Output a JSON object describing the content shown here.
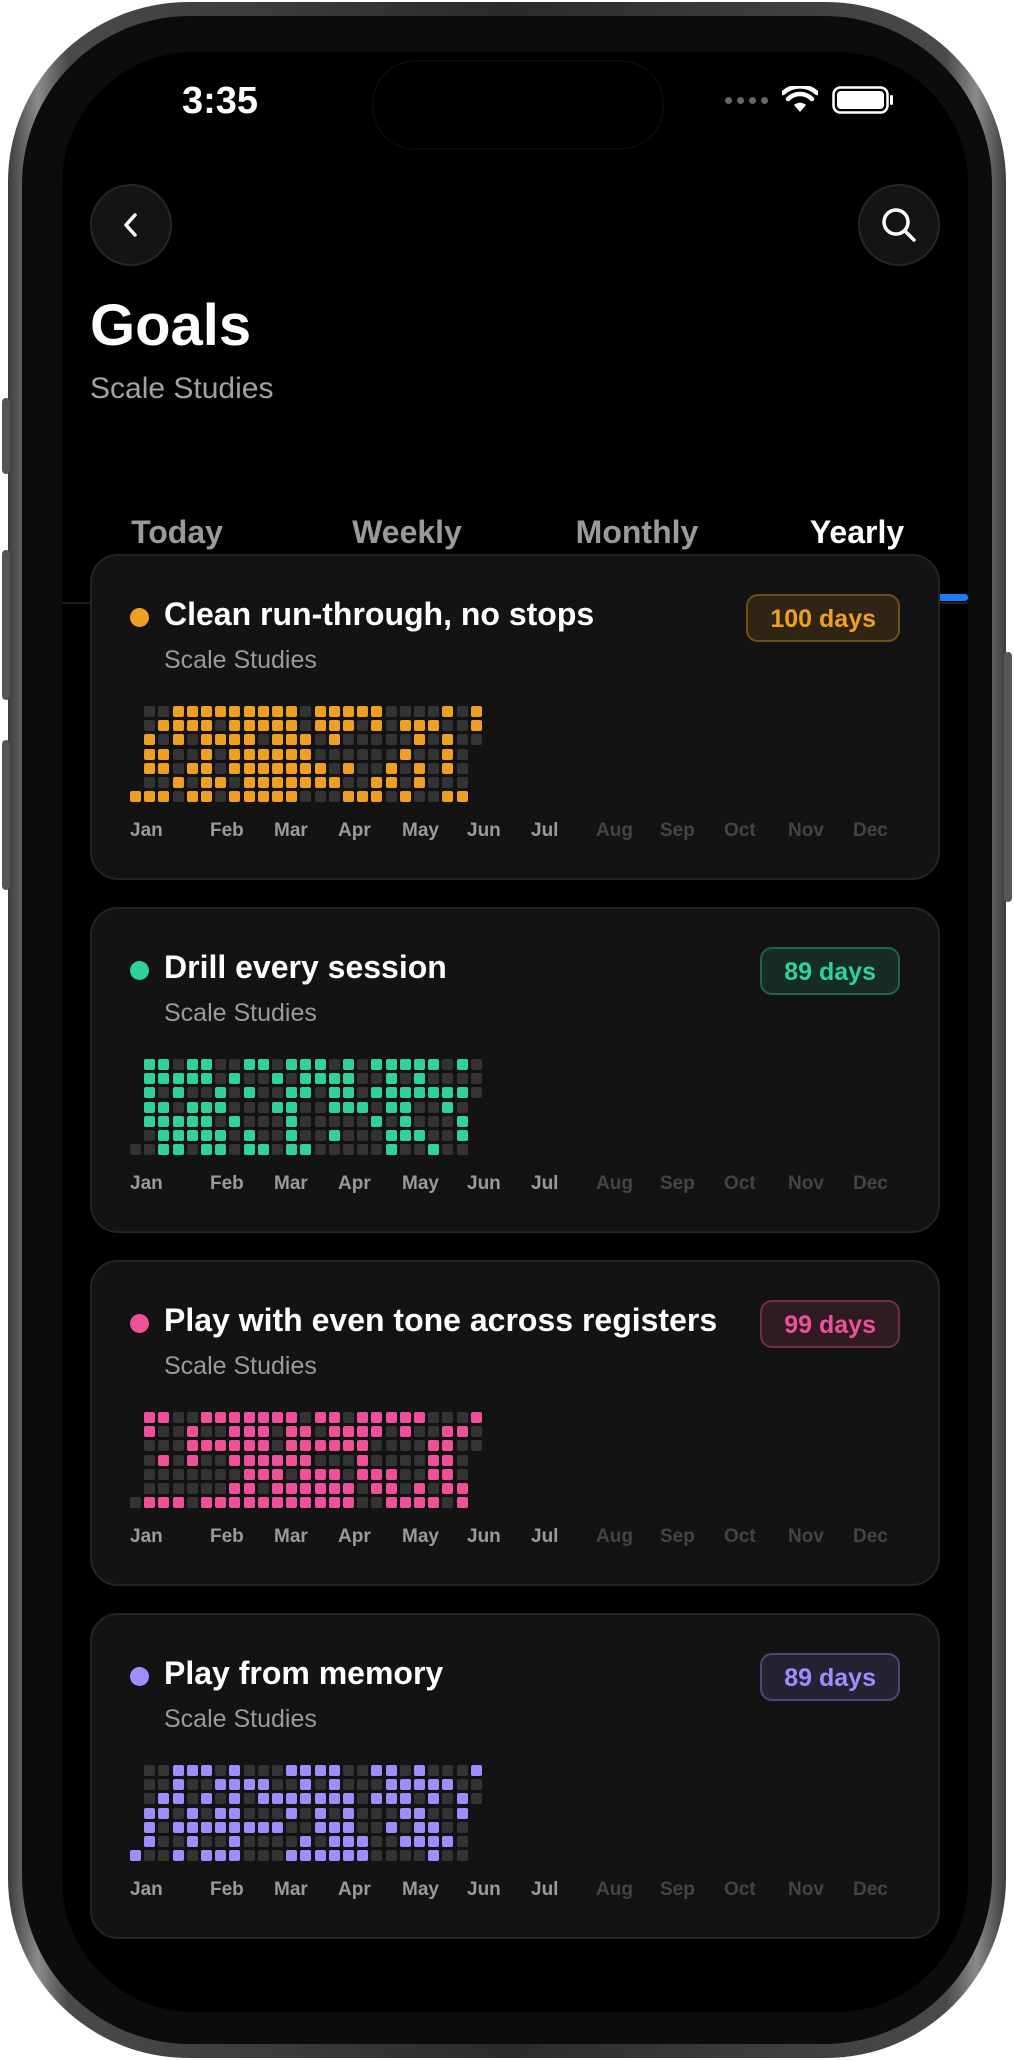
{
  "status": {
    "time": "3:35"
  },
  "header": {
    "title": "Goals",
    "subtitle": "Scale Studies"
  },
  "tabs": [
    {
      "label": "Today",
      "active": false
    },
    {
      "label": "Weekly",
      "active": false
    },
    {
      "label": "Monthly",
      "active": false
    },
    {
      "label": "Yearly",
      "active": true
    }
  ],
  "months": [
    "Jan",
    "Feb",
    "Mar",
    "Apr",
    "May",
    "Jun",
    "Jul",
    "Aug",
    "Sep",
    "Oct",
    "Nov",
    "Dec"
  ],
  "goals": [
    {
      "title": "Clean run-through, no stops",
      "subtitle": "Scale Studies",
      "badge": "100 days",
      "color": "#f0a020",
      "completed_days": 100
    },
    {
      "title": "Drill every session",
      "subtitle": "Scale Studies",
      "badge": "89 days",
      "color": "#2fd39a",
      "completed_days": 89
    },
    {
      "title": "Play with even tone across registers",
      "subtitle": "Scale Studies",
      "badge": "99 days",
      "color": "#f0509a",
      "completed_days": 99
    },
    {
      "title": "Play from memory",
      "subtitle": "Scale Studies",
      "badge": "89 days",
      "color": "#a08cff",
      "completed_days": 89
    }
  ],
  "colors": {
    "accent": "#1e7cf5",
    "empty_cell": "#333333",
    "card_bg": "#131313"
  }
}
